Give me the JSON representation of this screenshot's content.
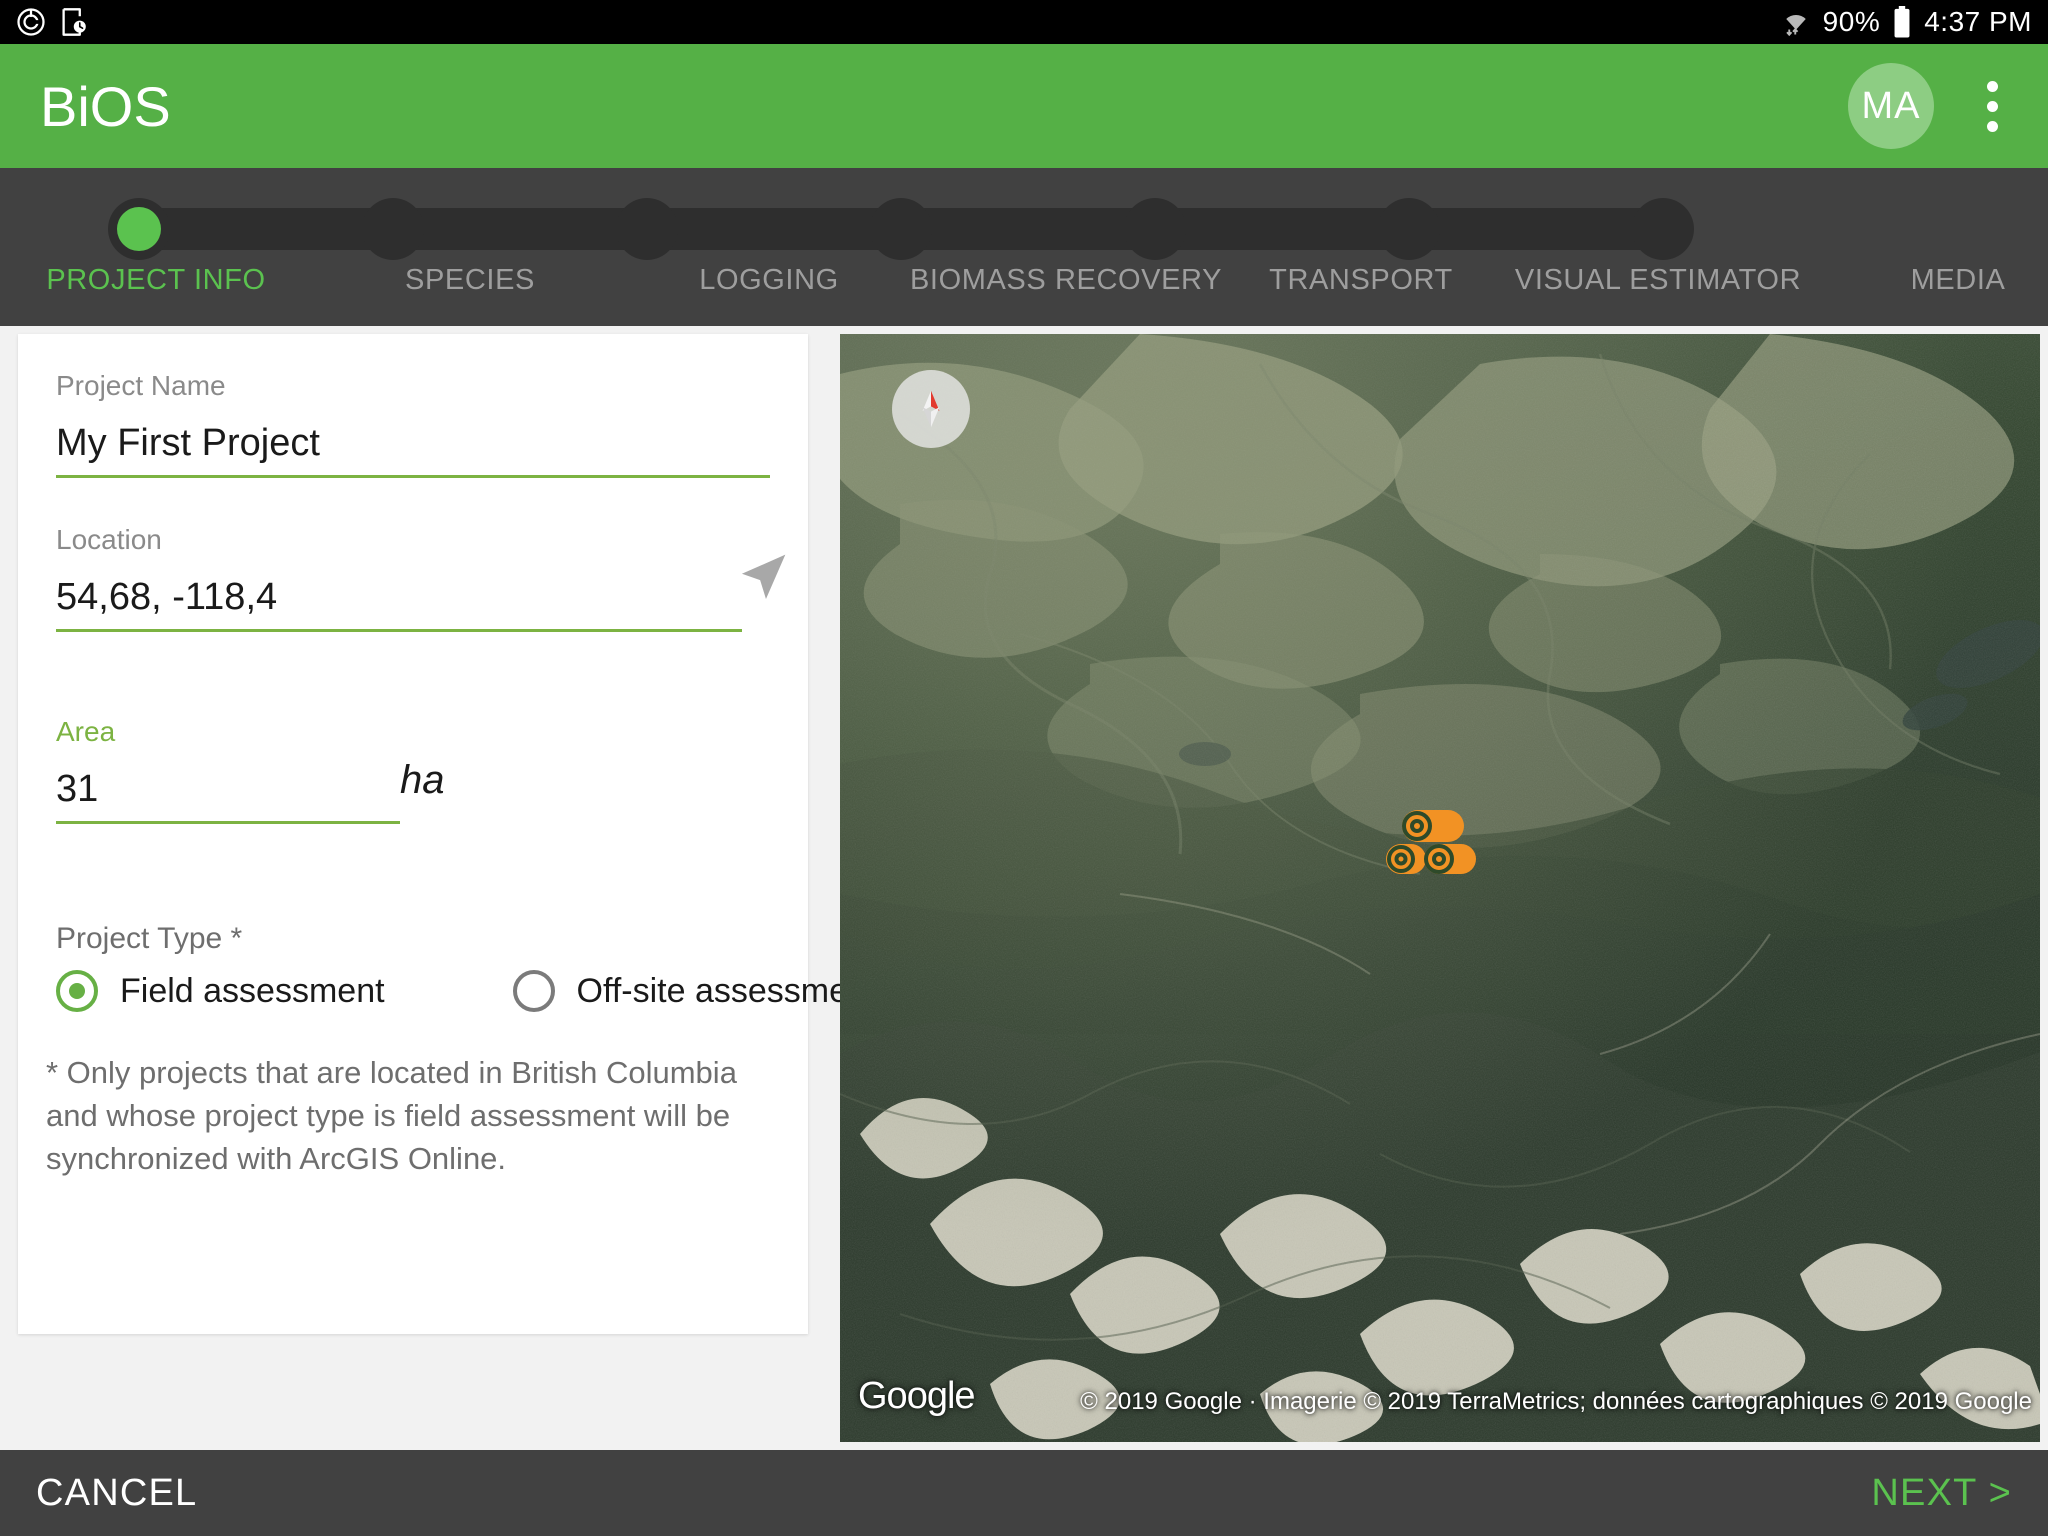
{
  "status_bar": {
    "left_icons": [
      "data-saver-icon",
      "screen-timer-icon"
    ],
    "wifi_icon": "wifi-icon",
    "battery_percent": "90%",
    "battery_icon": "battery-icon",
    "time": "4:37 PM"
  },
  "app_bar": {
    "title": "BiOS",
    "avatar_initials": "MA",
    "overflow_icon": "more-vertical-icon",
    "brand_color": "#55b046",
    "avatar_color": "#8dcd83"
  },
  "stepper": {
    "active_index": 0,
    "active_color": "#5bc24f",
    "inactive_color": "#9e9e9e",
    "background": "#414141",
    "steps": [
      {
        "label": "PROJECT INFO"
      },
      {
        "label": "SPECIES"
      },
      {
        "label": "LOGGING"
      },
      {
        "label": "BIOMASS RECOVERY"
      },
      {
        "label": "TRANSPORT"
      },
      {
        "label": "VISUAL ESTIMATOR"
      },
      {
        "label": "MEDIA"
      }
    ]
  },
  "form": {
    "project_name": {
      "label": "Project Name",
      "value": "My First Project",
      "placeholder": ""
    },
    "location": {
      "label": "Location",
      "value": "54,68, -118,4",
      "placeholder": "",
      "action_icon": "navigation-arrow-icon"
    },
    "area": {
      "label": "Area",
      "value": "31",
      "unit": "ha",
      "placeholder": ""
    },
    "project_type": {
      "label": "Project Type *",
      "selected": "Field assessment",
      "options": [
        {
          "label": "Field assessment",
          "checked": true
        },
        {
          "label": "Off-site assessment",
          "checked": false
        }
      ]
    },
    "disclaimer": "* Only projects that are located in British Columbia and whose project type is field assessment will be synchronized with ArcGIS Online."
  },
  "map": {
    "compass_icon": "compass-north-icon",
    "marker_icon": "log-pile-marker-icon",
    "marker_color": "#F29224",
    "provider_logo": "Google",
    "attribution": "© 2019 Google · Imagerie © 2019 TerraMetrics; données cartographiques © 2019 Google"
  },
  "bottom_bar": {
    "cancel_label": "CANCEL",
    "next_label": "NEXT >"
  }
}
